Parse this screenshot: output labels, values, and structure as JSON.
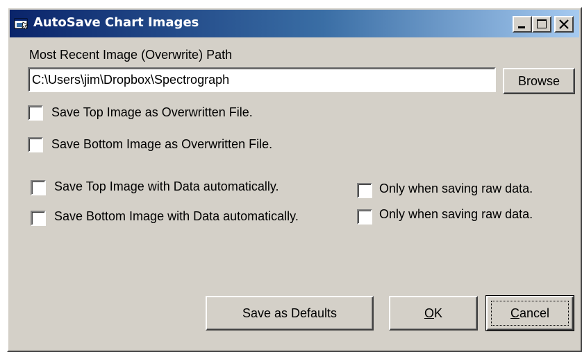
{
  "window": {
    "title": "AutoSave Chart Images",
    "icon": "chart-app-icon",
    "controls": {
      "minimize": "minimize-icon",
      "maximize": "maximize-icon",
      "close": "close-icon"
    }
  },
  "path_section": {
    "label": "Most Recent Image (Overwrite) Path",
    "value": "C:\\Users\\jim\\Dropbox\\Spectrograph",
    "browse_label": "Browse"
  },
  "checkboxes": {
    "top_overwrite": {
      "label": "Save Top Image as Overwritten File.",
      "checked": false
    },
    "bottom_overwrite": {
      "label": "Save Bottom Image as Overwritten File.",
      "checked": false
    },
    "top_auto": {
      "label": "Save Top Image with Data automatically.",
      "checked": false
    },
    "bottom_auto": {
      "label": "Save Bottom Image with Data automatically.",
      "checked": false
    },
    "top_raw_only": {
      "label": "Only when saving raw data.",
      "checked": false
    },
    "bottom_raw_only": {
      "label": "Only when saving raw data.",
      "checked": false
    }
  },
  "buttons": {
    "save_defaults": "Save as Defaults",
    "ok_mnemonic": "O",
    "ok_rest": "K",
    "cancel_mnemonic": "C",
    "cancel_rest": "ancel"
  }
}
